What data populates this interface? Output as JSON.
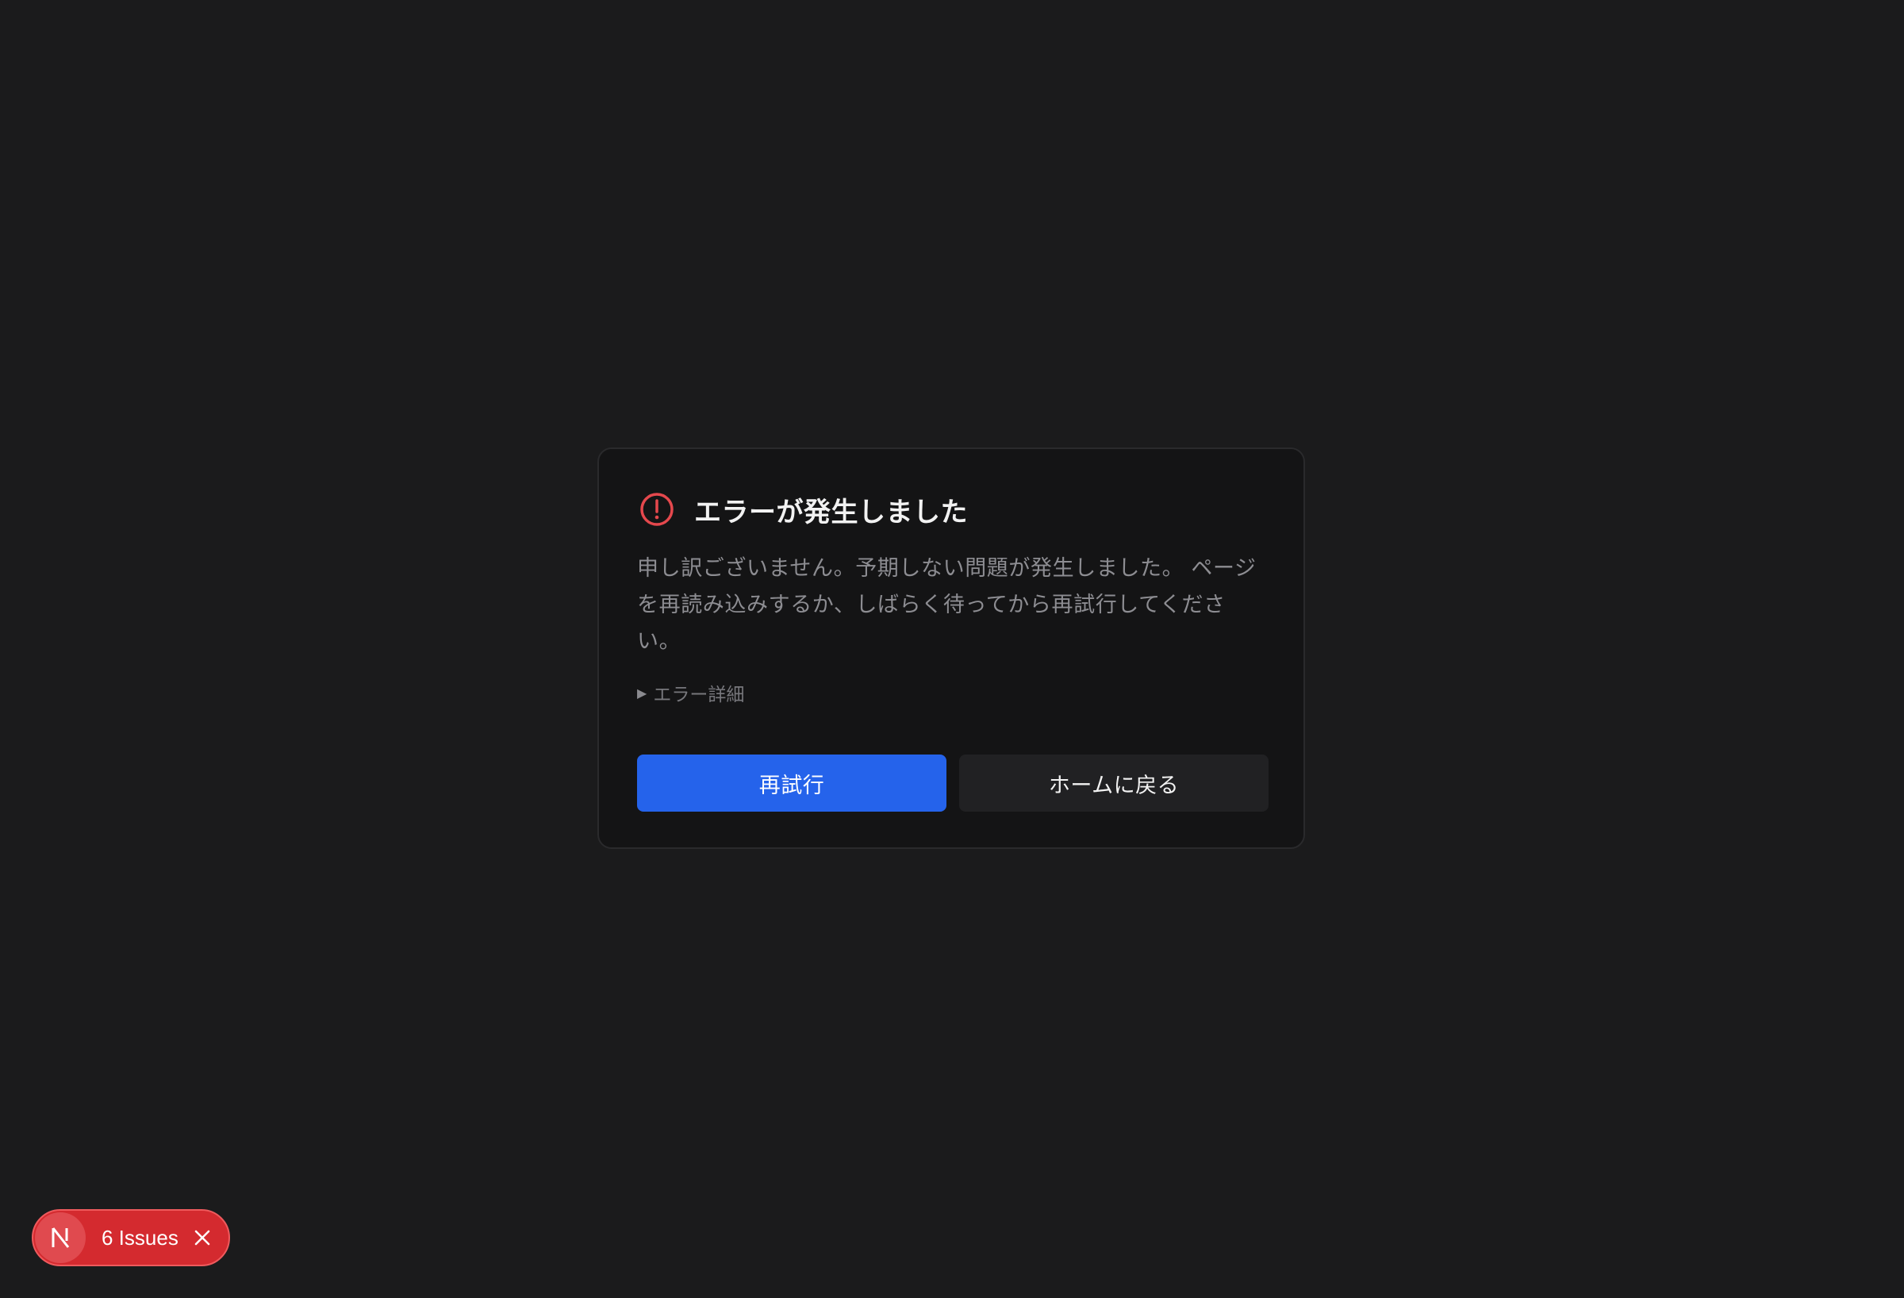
{
  "error_card": {
    "title": "エラーが発生しました",
    "icon": "alert-circle-icon",
    "message": "申し訳ございません。予期しない問題が発生しました。 ページを再読み込みするか、しばらく待ってから再試行してください。",
    "details_label": "エラー詳細",
    "buttons": {
      "retry_label": "再試行",
      "home_label": "ホームに戻る"
    }
  },
  "dev_indicator": {
    "badge_letter": "N",
    "issues_label": "6 Issues",
    "close_icon": "close-icon"
  },
  "colors": {
    "background": "#1b1b1c",
    "card_background": "#141415",
    "alert": "#e5484d",
    "primary_button": "#2563eb",
    "issues_pill": "#d42a2f"
  }
}
